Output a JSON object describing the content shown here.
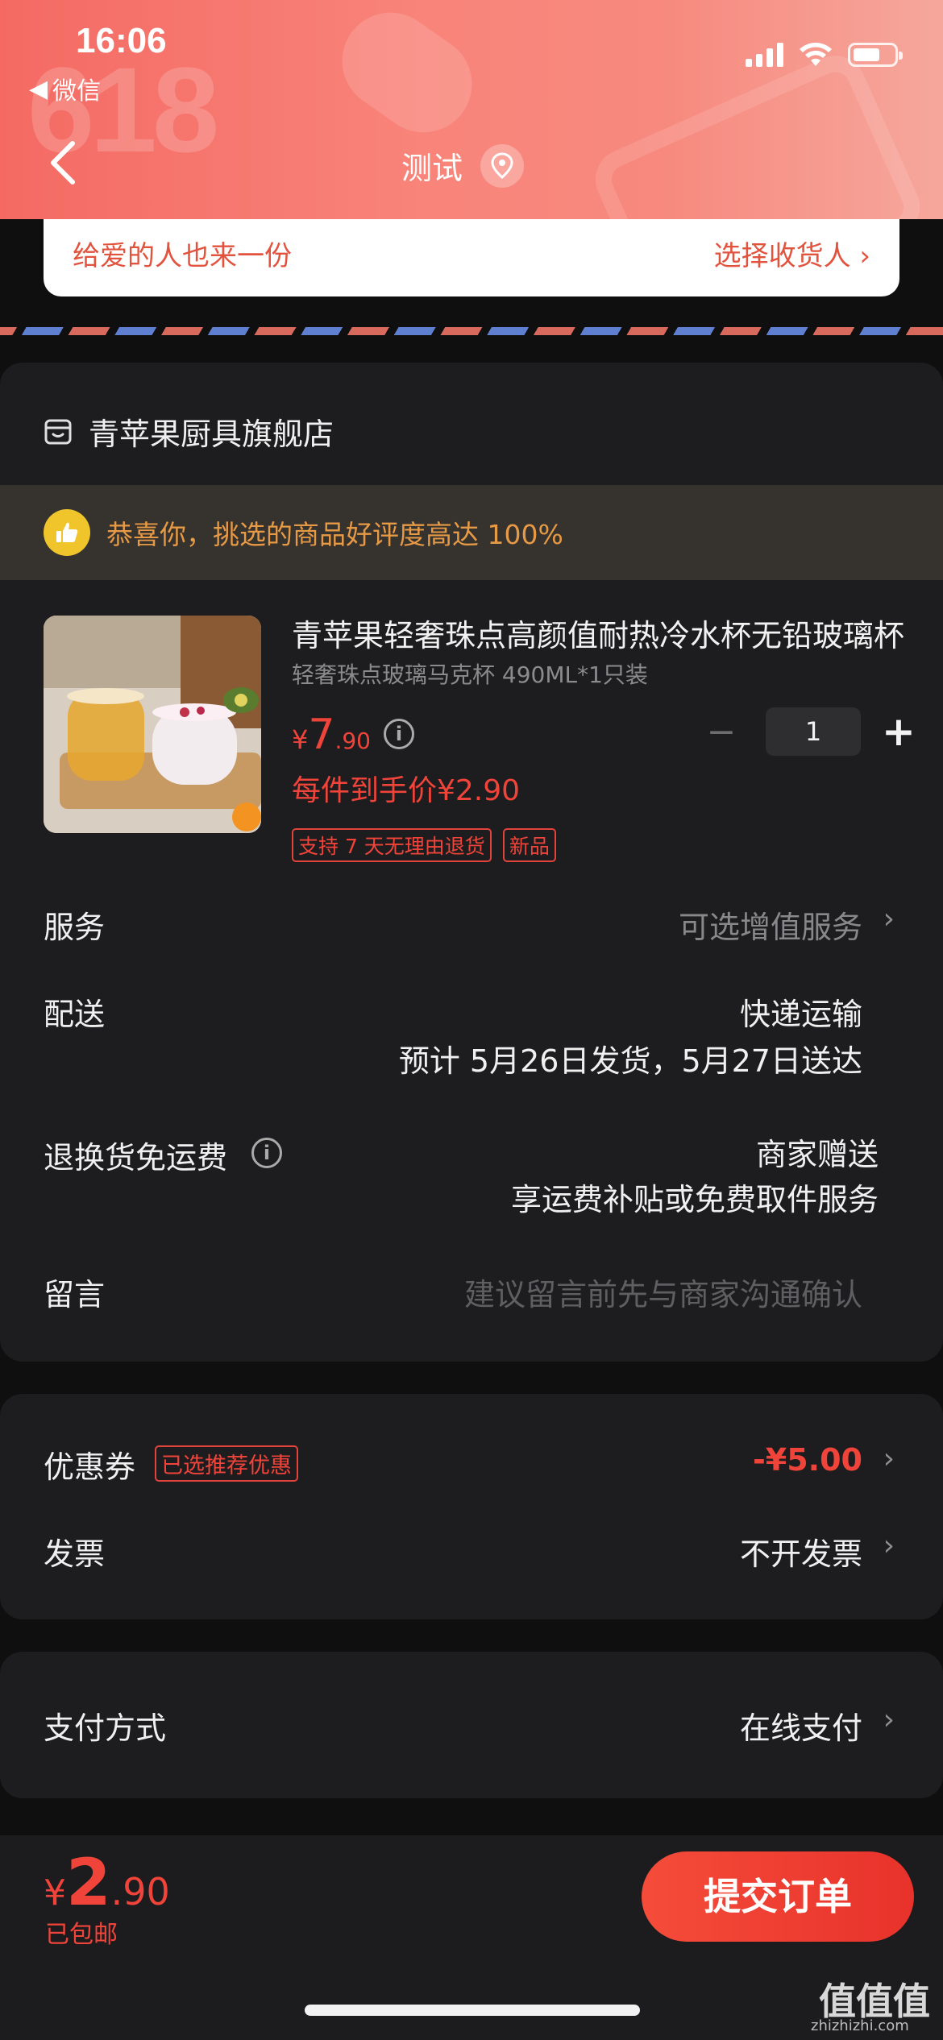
{
  "status_bar": {
    "time": "16:06",
    "back_app": "微信"
  },
  "nav": {
    "title": "测试"
  },
  "gift": {
    "left": "给爱的人也来一份",
    "right": "选择收货人"
  },
  "store": {
    "name": "青苹果厨具旗舰店"
  },
  "notice": {
    "text": "恭喜你，挑选的商品好评度高达 100%"
  },
  "product": {
    "title": "青苹果轻奢珠点高颜值耐热冷水杯无铅玻璃杯",
    "spec": "轻奢珠点玻璃马克杯 490ML*1只装",
    "price_currency": "¥",
    "price_int": "7",
    "price_dec": ".90",
    "per_price": "每件到手价¥2.90",
    "tags": [
      "支持 7 天无理由退货",
      "新品"
    ],
    "quantity": "1",
    "minus": "−",
    "plus": "+"
  },
  "rows": {
    "service_label": "服务",
    "service_value": "可选增值服务",
    "delivery_label": "配送",
    "delivery_value": "快递运输",
    "delivery_eta": "预计 5月26日发货，5月27日送达",
    "return_label": "退换货免运费",
    "return_value": "商家赠送",
    "return_value2": "享运费补贴或免费取件服务",
    "note_label": "留言",
    "note_placeholder": "建议留言前先与商家沟通确认"
  },
  "coupon": {
    "label": "优惠券",
    "tag": "已选推荐优惠",
    "value": "-¥5.00"
  },
  "invoice": {
    "label": "发票",
    "value": "不开发票"
  },
  "payment": {
    "label": "支付方式",
    "value": "在线支付"
  },
  "footer": {
    "currency": "¥",
    "total_int": "2",
    "total_dec": ".90",
    "shipping": "已包邮",
    "submit": "提交订单"
  },
  "watermark": {
    "main": "值值值",
    "sub": "zhizhizhi.com"
  },
  "colors": {
    "accent": "#f0443a",
    "header": "#f47a70",
    "card": "#1d1d1f",
    "background": "#0f0f10"
  }
}
